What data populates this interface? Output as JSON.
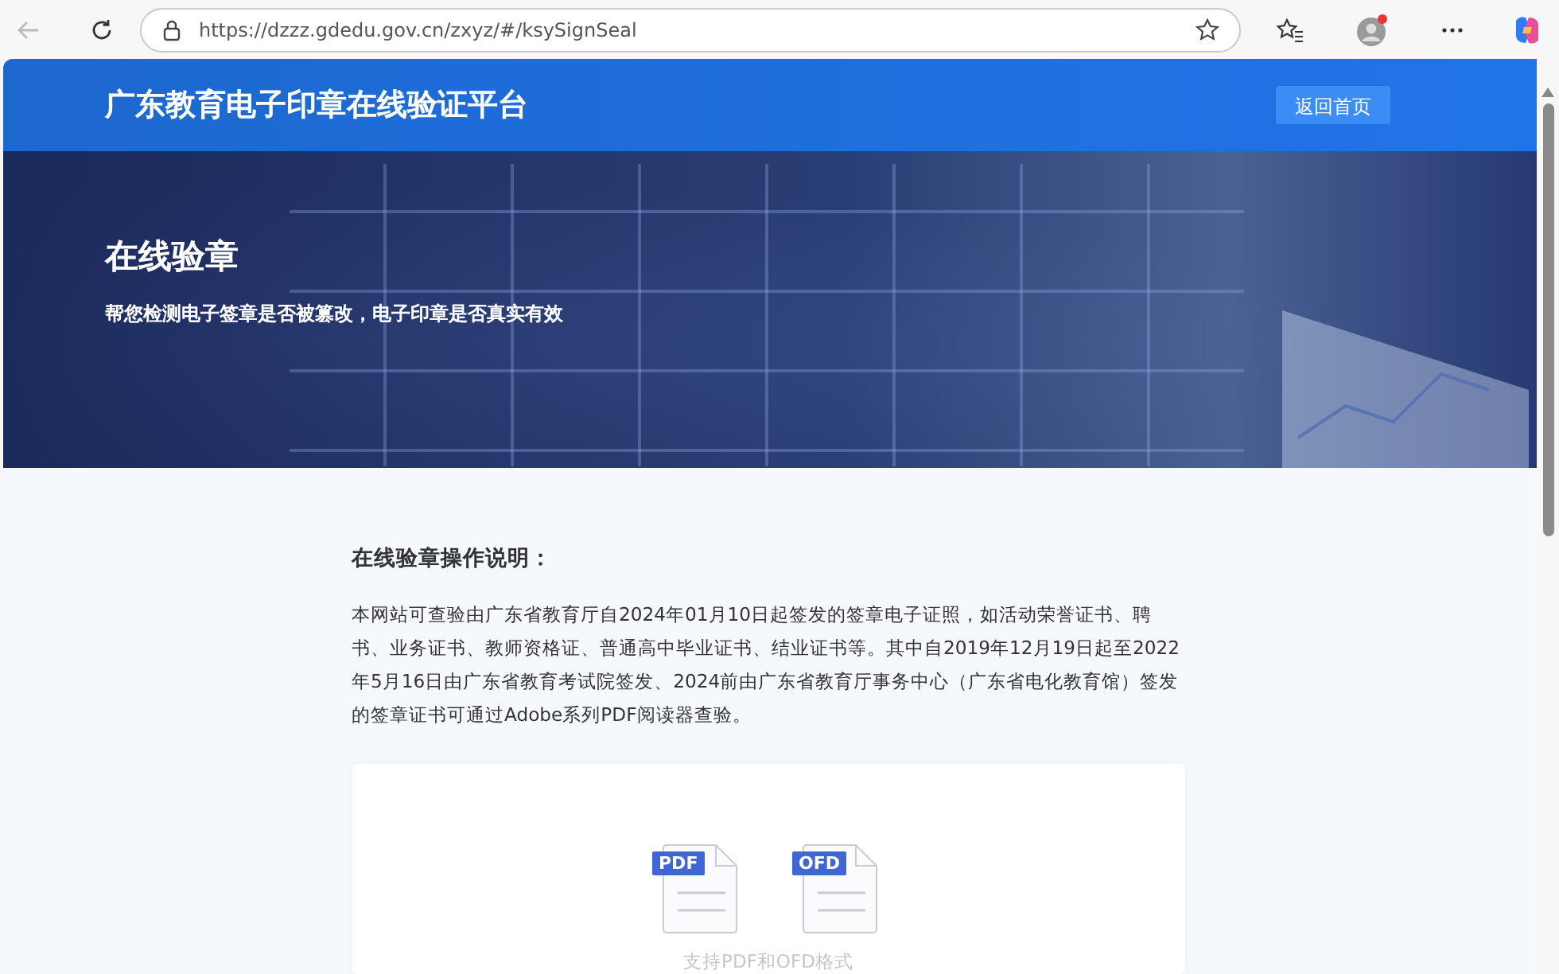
{
  "browser": {
    "url": "https://dzzz.gdedu.gov.cn/zxyz/#/ksySignSeal"
  },
  "header": {
    "title": "广东教育电子印章在线验证平台",
    "home_button": "返回首页"
  },
  "banner": {
    "title": "在线验章",
    "subtitle": "帮您检测电子签章是否被篡改，电子印章是否真实有效"
  },
  "instructions": {
    "heading": "在线验章操作说明：",
    "text": "本网站可查验由广东省教育厅自2024年01月10日起签发的签章电子证照，如活动荣誉证书、聘书、业务证书、教师资格证、普通高中毕业证书、结业证书等。其中自2019年12月19日起至2022年5月16日由广东省教育考试院签发、2024前由广东省教育厅事务中心（广东省电化教育馆）签发的签章证书可通过Adobe系列PDF阅读器查验。"
  },
  "upload": {
    "formats": [
      {
        "label": "PDF"
      },
      {
        "label": "OFD"
      }
    ],
    "hint": "支持PDF和OFD格式"
  }
}
